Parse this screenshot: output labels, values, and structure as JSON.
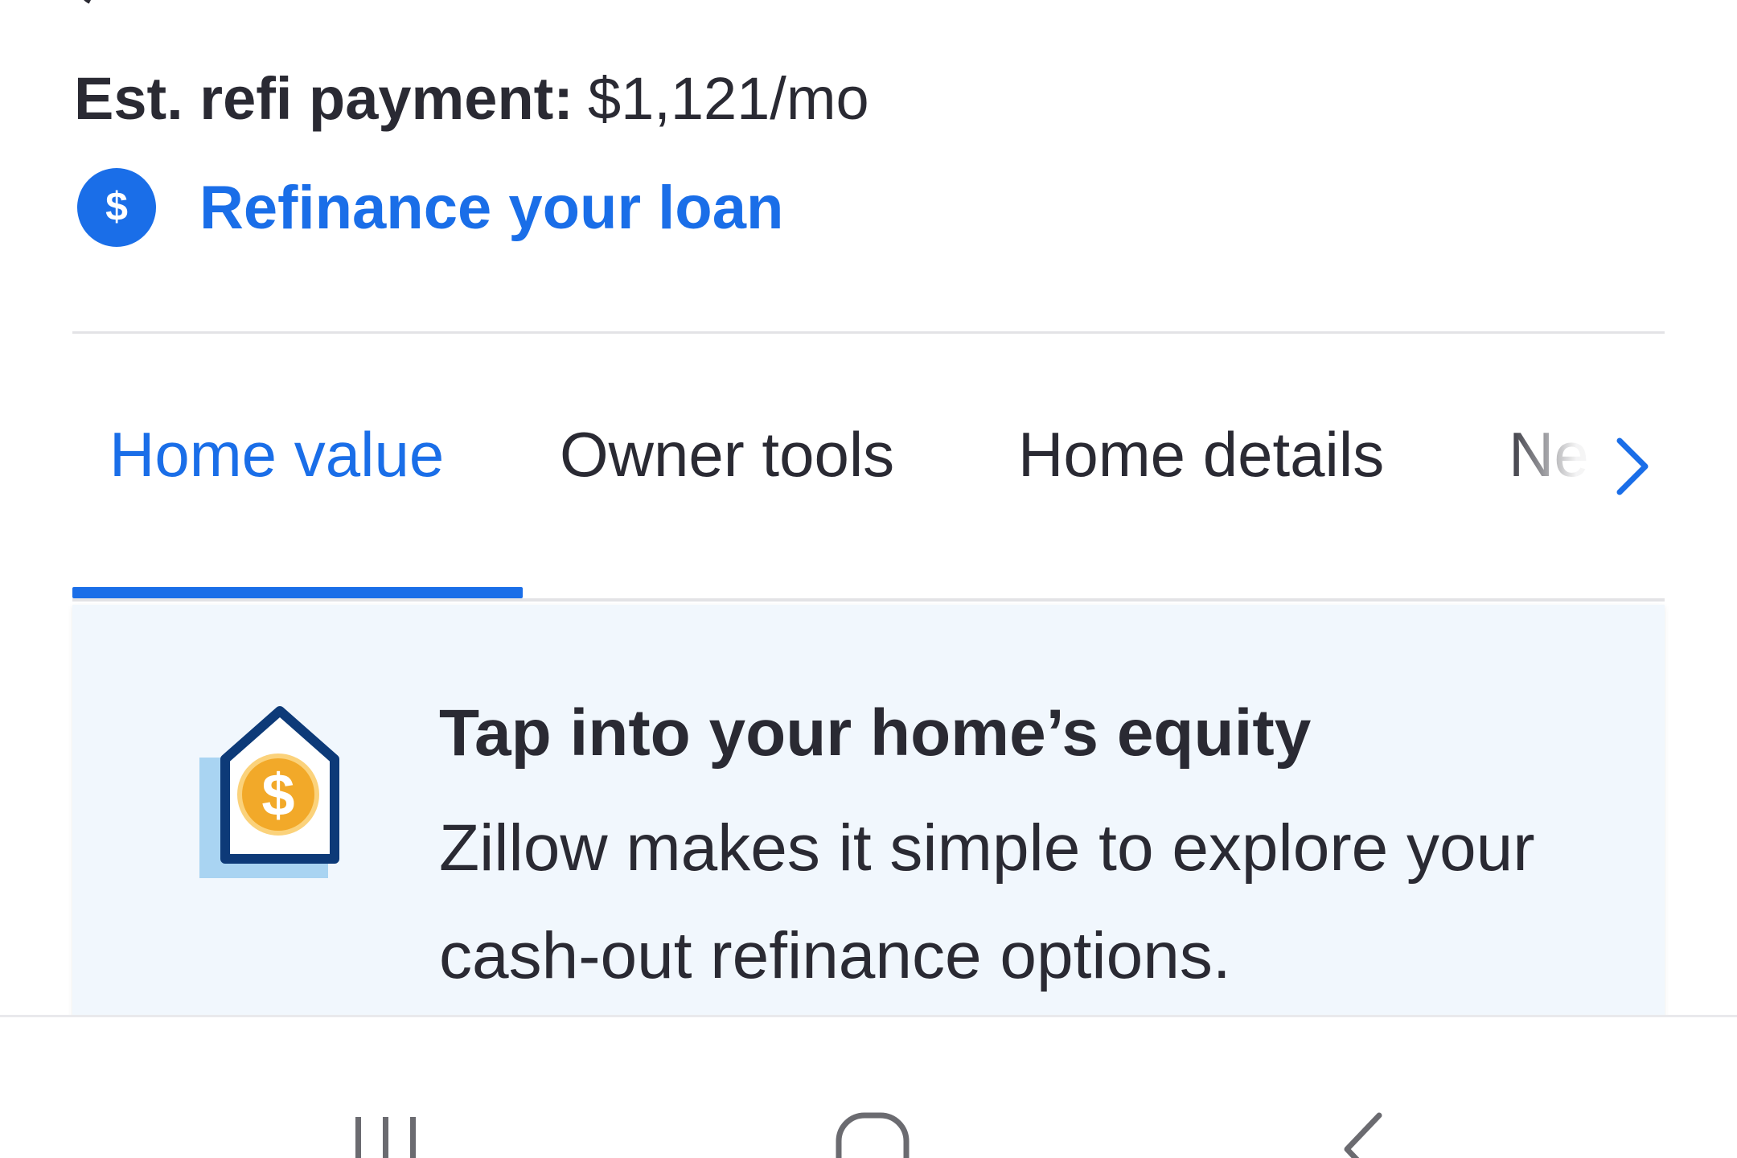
{
  "payment": {
    "label": "Est. refi payment:",
    "value": "$1,121/mo"
  },
  "refinance_link": {
    "icon": "dollar-icon",
    "label": "Refinance your loan"
  },
  "tabs": [
    {
      "label": "Home value",
      "active": true
    },
    {
      "label": "Owner tools",
      "active": false
    },
    {
      "label": "Home details",
      "active": false
    },
    {
      "label": "Ne",
      "active": false
    }
  ],
  "tabs_next_icon": "chevron-right-icon",
  "promo": {
    "icon": "house-dollar-icon",
    "title": "Tap into your home’s equity",
    "body": "Zillow makes it simple to explore your cash-out refinance options."
  },
  "system_nav": {
    "recents_icon": "recents-icon",
    "home_icon": "home-icon",
    "back_icon": "back-icon"
  },
  "colors": {
    "accent": "#1a6ee8",
    "text": "#2a2a33",
    "card_bg": "#f1f7fd",
    "coin": "#f2a929",
    "house_outline": "#0d3a78",
    "house_shadow": "#a9d4f2"
  }
}
